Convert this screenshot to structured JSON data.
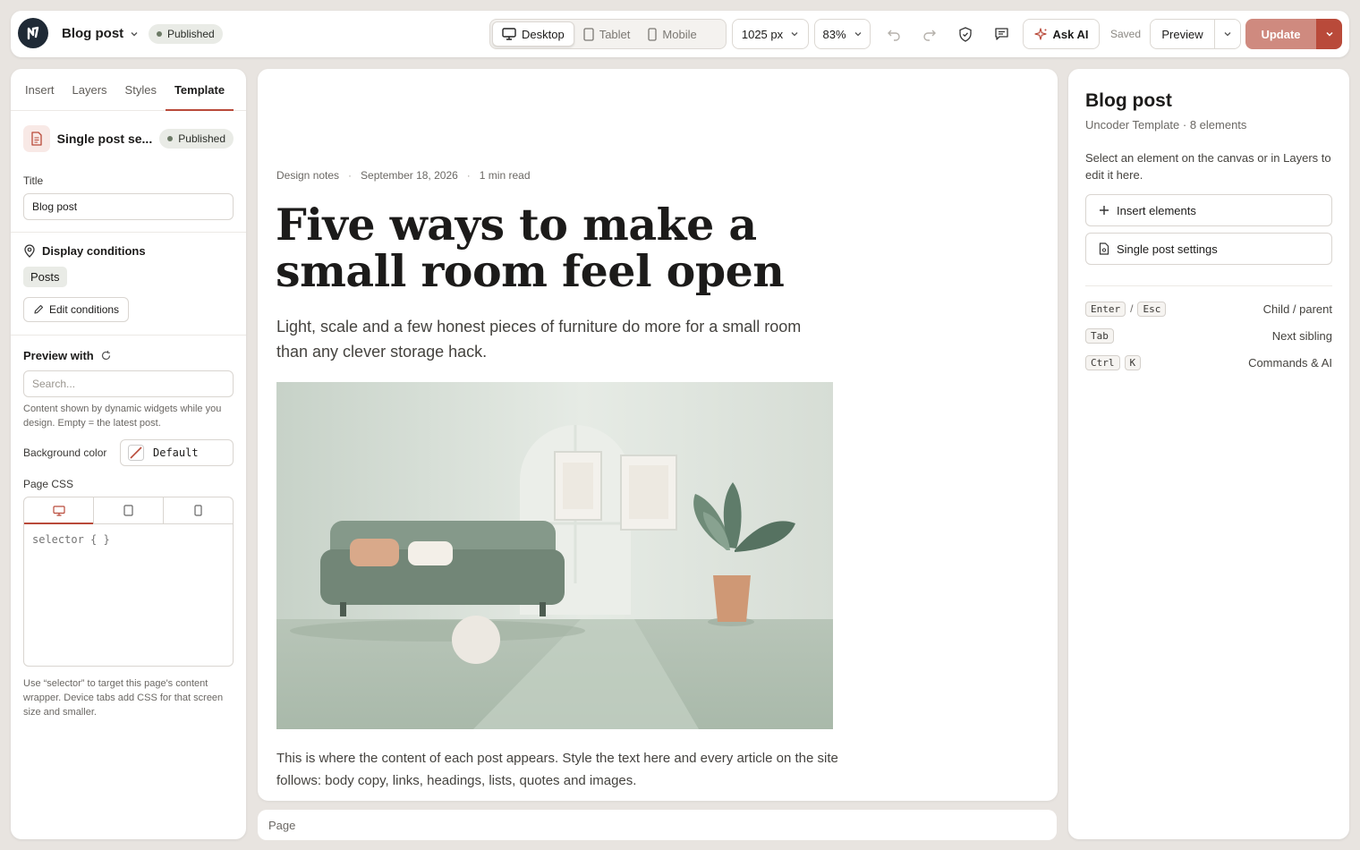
{
  "topbar": {
    "doc_title": "Blog post",
    "status": "Published",
    "devices": [
      {
        "label": "Desktop",
        "icon": "desktop-icon",
        "active": true
      },
      {
        "label": "Tablet",
        "icon": "tablet-icon",
        "active": false
      },
      {
        "label": "Mobile",
        "icon": "mobile-icon",
        "active": false
      }
    ],
    "width_value": "1025 px",
    "zoom_value": "83%",
    "ask_ai": "Ask AI",
    "save_state": "Saved",
    "preview": "Preview",
    "update": "Update"
  },
  "left": {
    "tabs": [
      "Insert",
      "Layers",
      "Styles",
      "Template"
    ],
    "active_tab": "Template",
    "template_name": "Single post se...",
    "template_status": "Published",
    "title_label": "Title",
    "title_value": "Blog post",
    "display_conditions_label": "Display conditions",
    "condition_chip": "Posts",
    "edit_conditions": "Edit conditions",
    "preview_with_label": "Preview with",
    "search_placeholder": "Search...",
    "preview_help": "Content shown by dynamic widgets while you design. Empty = the latest post.",
    "bg_label": "Background color",
    "bg_value": "Default",
    "page_css_label": "Page CSS",
    "css_placeholder": "selector { }",
    "css_help": "Use “selector” to target this page's content wrapper. Device tabs add CSS for that screen size and smaller."
  },
  "canvas": {
    "category": "Design notes",
    "date": "September 18, 2026",
    "read_time": "1 min read",
    "headline": "Five ways to make a small room feel open",
    "lede": "Light, scale and a few honest pieces of furniture do more for a small room than any clever storage hack.",
    "body": "This is where the content of each post appears. Style the text here and every article on the site follows: body copy, links, headings, lists, quotes and images."
  },
  "statusbar": {
    "breadcrumb": "Page"
  },
  "right": {
    "title": "Blog post",
    "subtitle": "Uncoder Template · 8 elements",
    "description": "Select an element on the canvas or in Layers to edit it here.",
    "insert_button": "Insert elements",
    "settings_button": "Single post settings",
    "shortcuts": [
      {
        "keys": [
          "Enter",
          "Esc"
        ],
        "sep": "/",
        "desc": "Child / parent"
      },
      {
        "keys": [
          "Tab"
        ],
        "desc": "Next sibling"
      },
      {
        "keys": [
          "Ctrl",
          "K"
        ],
        "desc": "Commands & AI"
      }
    ]
  },
  "colors": {
    "accent": "#b94a3a",
    "update_bg": "#cf8a7f",
    "published_badge": "#e9ebe6"
  }
}
